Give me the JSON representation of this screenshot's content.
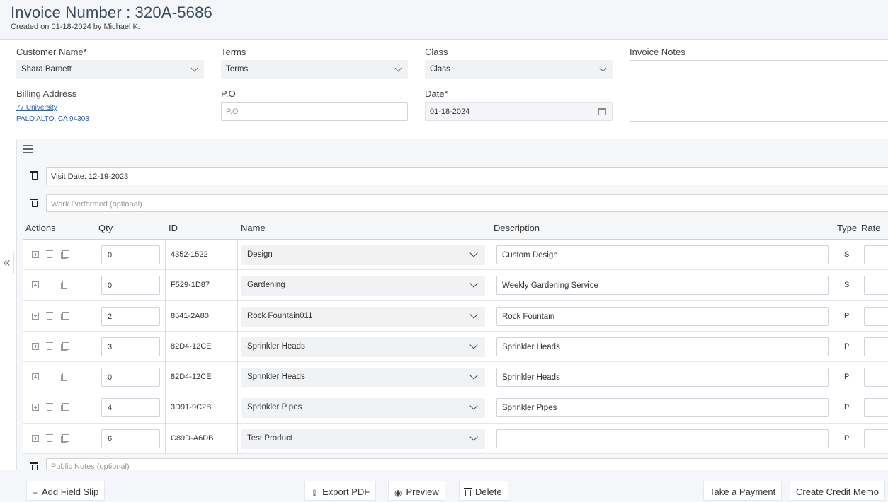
{
  "header": {
    "title_label": "Invoice Number :",
    "invoice_number": "320A-5686",
    "subtitle": "Created on 01-18-2024 by Michael K."
  },
  "form": {
    "customer_label": "Customer Name*",
    "customer_value": "Shara Barnett",
    "terms_label": "Terms",
    "terms_value": "Terms",
    "class_label": "Class",
    "class_value": "Class",
    "notes_label": "Invoice Notes",
    "billing_label": "Billing Address",
    "billing_line1": "77 University",
    "billing_line2": "PALO ALTO, CA 94303",
    "po_label": "P.O",
    "po_placeholder": "P.O",
    "date_label": "Date*",
    "date_value": "01-18-2024"
  },
  "slip": {
    "visit_date": "Visit Date: 12-19-2023",
    "work_placeholder": "Work Performed (optional)",
    "public_notes_placeholder": "Public Notes (optional)"
  },
  "table": {
    "headers": [
      "Actions",
      "Qty",
      "ID",
      "Name",
      "Description",
      "Type",
      "Rate"
    ],
    "rows": [
      {
        "qty": "0",
        "id": "4352-1522",
        "name": "Design",
        "description": "Custom Design",
        "type": "S"
      },
      {
        "qty": "0",
        "id": "F529-1D87",
        "name": "Gardening",
        "description": "Weekly Gardening Service",
        "type": "S"
      },
      {
        "qty": "2",
        "id": "8541-2A80",
        "name": "Rock Fountain011",
        "description": "Rock Fountain",
        "type": "P"
      },
      {
        "qty": "3",
        "id": "82D4-12CE",
        "name": "Sprinkler Heads",
        "description": "Sprinkler Heads",
        "type": "P"
      },
      {
        "qty": "0",
        "id": "82D4-12CE",
        "name": "Sprinkler Heads",
        "description": "Sprinkler Heads",
        "type": "P"
      },
      {
        "qty": "4",
        "id": "3D91-9C2B",
        "name": "Sprinkler Pipes",
        "description": "Sprinkler Pipes",
        "type": "P"
      },
      {
        "qty": "6",
        "id": "C89D-A6DB",
        "name": "Test Product",
        "description": "",
        "type": "P"
      }
    ]
  },
  "footer": {
    "add_field_slip": "Add Field Slip",
    "export_pdf": "Export PDF",
    "preview": "Preview",
    "delete": "Delete",
    "take_payment": "Take a Payment",
    "credit_memo": "Create Credit Memo"
  },
  "icons": {
    "collapse": "«",
    "add": "+",
    "export": "⇪",
    "preview": "◉"
  }
}
